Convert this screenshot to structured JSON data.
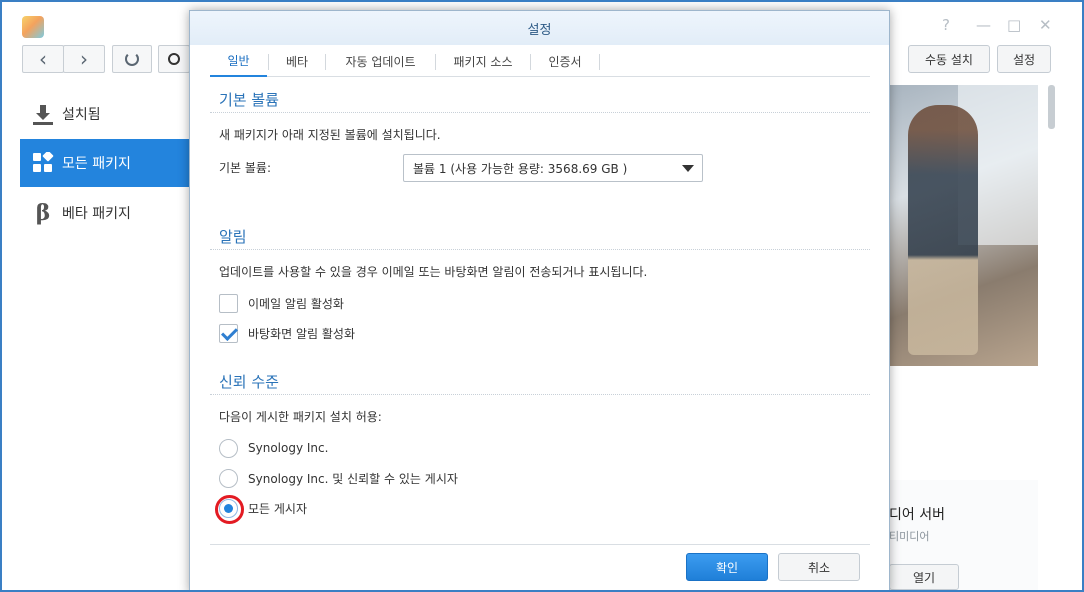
{
  "main_window": {
    "window_controls": {
      "help": "?",
      "minimize": "—",
      "maximize": "□",
      "close": "✕"
    },
    "toolbar": {
      "back": "‹",
      "forward": "›",
      "refresh": "C"
    },
    "actions": {
      "manual_install": "수동 설치",
      "settings": "설정"
    },
    "sidebar": {
      "items": [
        {
          "label": "설치됨",
          "icon": "download-icon"
        },
        {
          "label": "모든 패키지",
          "icon": "grid-icon",
          "active": true
        },
        {
          "label": "베타 패키지",
          "icon": "beta-icon"
        }
      ]
    },
    "card": {
      "title": "디어 서버",
      "subtitle": "티미디어",
      "open_button": "열기"
    }
  },
  "dialog": {
    "title": "설정",
    "tabs": [
      {
        "label": "일반",
        "active": true
      },
      {
        "label": "베타"
      },
      {
        "label": "자동 업데이트"
      },
      {
        "label": "패키지 소스"
      },
      {
        "label": "인증서"
      }
    ],
    "volume": {
      "section_title": "기본 볼륨",
      "description": "새 패키지가 아래 지정된 볼륨에 설치됩니다.",
      "field_label": "기본 볼륨:",
      "selected_value": "볼륨 1 (사용 가능한 용량:  3568.69 GB )"
    },
    "notifications": {
      "section_title": "알림",
      "description": "업데이트를 사용할 수 있을 경우 이메일 또는 바탕화면 알림이 전송되거나 표시됩니다.",
      "options": [
        {
          "label": "이메일 알림 활성화",
          "checked": false
        },
        {
          "label": "바탕화면 알림 활성화",
          "checked": true
        }
      ]
    },
    "trust": {
      "section_title": "신뢰 수준",
      "description": "다음이 게시한 패키지 설치 허용:",
      "options": [
        {
          "label": "Synology Inc.",
          "selected": false
        },
        {
          "label": "Synology Inc. 및 신뢰할 수 있는 게시자",
          "selected": false
        },
        {
          "label": "모든 게시자",
          "selected": true
        }
      ]
    },
    "buttons": {
      "confirm": "확인",
      "cancel": "취소"
    }
  },
  "colors": {
    "accent": "#2384dd",
    "section_title": "#2a73b8",
    "highlight_ring": "#e31b23"
  }
}
